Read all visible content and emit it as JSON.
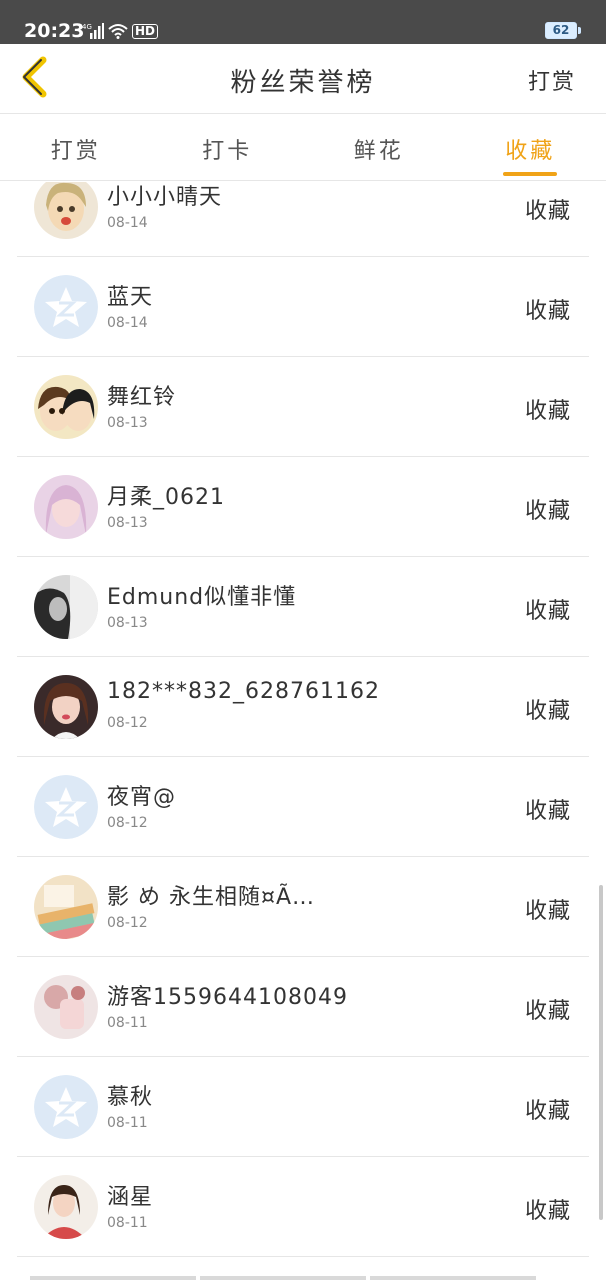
{
  "status_bar": {
    "time": "20:23",
    "network": "4G",
    "hd": "HD",
    "battery": "62"
  },
  "header": {
    "title": "粉丝荣誉榜",
    "action": "打赏"
  },
  "tabs": [
    {
      "label": "打赏",
      "active": false
    },
    {
      "label": "打卡",
      "active": false
    },
    {
      "label": "鲜花",
      "active": false
    },
    {
      "label": "收藏",
      "active": true
    }
  ],
  "colors": {
    "accent": "#f0a318",
    "text": "#333333",
    "subtext": "#888888",
    "divider": "#e6e6e6",
    "default_avatar": "#dde9f6"
  },
  "items": [
    {
      "name": "小小小晴天",
      "date": "08-14",
      "type": "收藏",
      "avatar": "photo-girl-yellow"
    },
    {
      "name": "蓝天",
      "date": "08-14",
      "type": "收藏",
      "avatar": "default-avatar"
    },
    {
      "name": "舞红铃",
      "date": "08-13",
      "type": "收藏",
      "avatar": "anime-pair"
    },
    {
      "name": "月柔_0621",
      "date": "08-13",
      "type": "收藏",
      "avatar": "photo-pink"
    },
    {
      "name": "Edmund似懂非懂",
      "date": "08-13",
      "type": "收藏",
      "avatar": "photo-bw"
    },
    {
      "name": "182***832_628761162",
      "date": "08-12",
      "type": "收藏",
      "avatar": "photo-girl-dark"
    },
    {
      "name": "夜宵@",
      "date": "08-12",
      "type": "收藏",
      "avatar": "default-avatar"
    },
    {
      "name": "影 め 永生相随¤Ã…",
      "date": "08-12",
      "type": "收藏",
      "avatar": "photo-books"
    },
    {
      "name": "游客1559644108049",
      "date": "08-11",
      "type": "收藏",
      "avatar": "photo-pink-light"
    },
    {
      "name": "慕秋",
      "date": "08-11",
      "type": "收藏",
      "avatar": "default-avatar"
    },
    {
      "name": "涵星",
      "date": "08-11",
      "type": "收藏",
      "avatar": "photo-girl-red"
    }
  ]
}
